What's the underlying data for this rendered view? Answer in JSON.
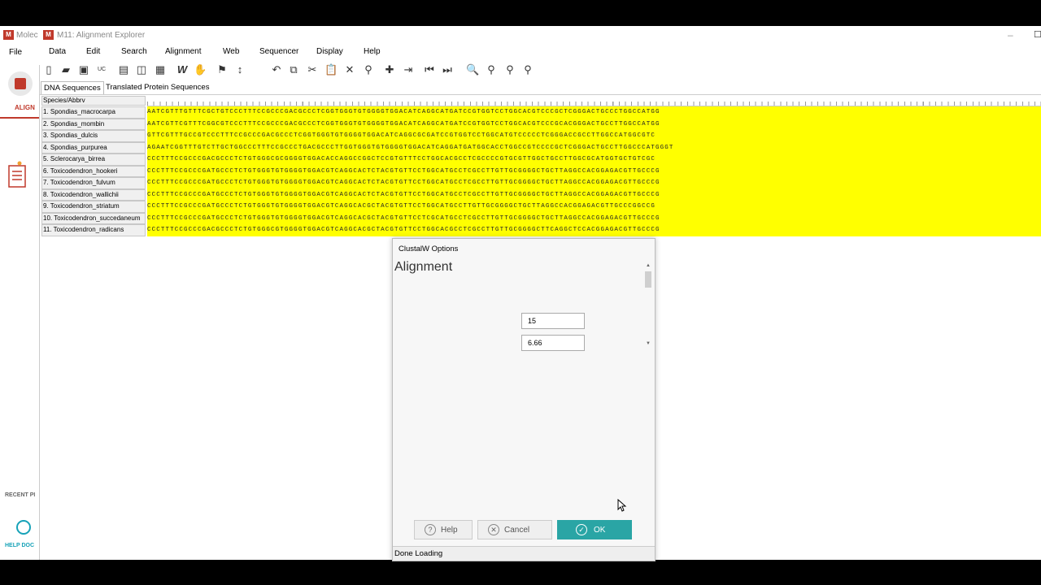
{
  "mega": {
    "title": "Molec",
    "file_menu": "File",
    "align_label": "ALIGN",
    "recent_label": "RECENT PI",
    "help_label": "HELP DOC"
  },
  "window": {
    "title": "M11: Alignment Explorer",
    "menus": [
      "Data",
      "Edit",
      "Search",
      "Alignment",
      "Web",
      "Sequencer",
      "Display",
      "Help"
    ],
    "tabs": [
      "DNA Sequences",
      "Translated Protein Sequences"
    ],
    "active_tab": "DNA Sequences"
  },
  "toolbar_icons": [
    "new-file-icon",
    "open-folder-icon",
    "save-icon",
    "uppercase-icon",
    "page-icon",
    "columns-icon",
    "grid-icon",
    "w-align-icon",
    "muscle-icon",
    "flag-icon",
    "sort-icon",
    "undo-icon",
    "copy-icon",
    "cut-icon",
    "paste-icon",
    "delete-icon",
    "find-icon",
    "add-icon",
    "import-icon",
    "prev-icon",
    "next-icon",
    "zoom-search-icon",
    "search-prev-icon",
    "search-next-icon",
    "search-clear-icon"
  ],
  "grid": {
    "header": "Species/Abbrv",
    "rows": [
      {
        "name": "1. Spondias_macrocarpa",
        "seq": "AATCGTTTGTTTCGCTGTCCCTTTCCGCCCGACGCCCTCGGTGGGTGTGGGGTGGACATCAGGCATGATCCGTGGTCCTGGCACGTCCCGCTCGGGACTGCCCTGGCCATGG"
      },
      {
        "name": "2. Spondias_mombin",
        "seq": "AATCGTTCGTTTCGGCGTCCCTTTCCGCCCGACGCCCTCGGTGGGTGTGGGGTGGACATCAGGCATGATCCGTGGTCCTGGCACGTCCCGCACGGGACTGCCTTGGCCATGG"
      },
      {
        "name": "3. Spondias_dulcis",
        "seq": "GTTCGTTTGCCGTCCCTTTCCGCCCGACGCCCTCGGTGGGTGTGGGGTGGACATCAGGCGCGATCCGTGGTCCTGGCATGTCCCCCTCGGGACCGCCTTGGCCATGGCGTC"
      },
      {
        "name": "4. Spondias_purpurea",
        "seq": "AGAATCGGTTTGTCTTGCTGGCCCTTTCCGCCCTGACGCCCTTGGTGGGTGTGGGGTGGACATCAGGATGATGGCACCTGGCCGTCCCCGCTCGGGACTGCCTTGGCCCATGGGT"
      },
      {
        "name": "5. Sclerocarya_birrea",
        "seq": "CCCTTTCCGCCCGACGCCCTCTGTGGGCGCGGGGTGGACACCAGGCCGGCTCCGTGTTTCCTGGCACGCCTCGCCCCGTGCGTTGGCTGCCTTGGCGCATGGTGCTGTCGC"
      },
      {
        "name": "6. Toxicodendron_hookeri",
        "seq": "CCCTTTCCGCCCGATGCCCTCTGTGGGTGTGGGGTGGACGTCAGGCACTCTACGTGTTCCTGGCATGCCTCGCCTTGTTGCGGGGCTGCTTAGGCCACGGAGACGTTGCCCG"
      },
      {
        "name": "7. Toxicodendron_fulvum",
        "seq": "CCCTTTCCGCCCGATGCCCTCTGTGGGTGTGGGGTGGACGTCAGGCACTCTACGTGTTCCTGGCATGCCTCGCCTTGTTGCGGGGCTGCTTAGGCCACGGAGACGTTGCCCG"
      },
      {
        "name": "8. Toxicodendron_wallichii",
        "seq": "CCCTTTCCGCCCGATGCCCTCTGTGGGTGTGGGGTGGACGTCAGGCACTCTACGTGTTCCTGGCATGCCTCGCCTTGTTGCGGGGCTGCTTAGGCCACGGAGACGTTGCCCG"
      },
      {
        "name": "9. Toxicodendron_striatum",
        "seq": "CCCTTTCCGCCCGATGCCCTCTGTGGGTGTGGGGTGGACGTCAGGCACGCTACGTGTTCCTGGCATGCCTTGTTGCGGGGCTGCTTAGGCCACGGAGACGTTGCCCGGCCG"
      },
      {
        "name": "10. Toxicodendron_succedaneum",
        "seq": "CCCTTTCCGCCCGATGCCCTCTGTGGGTGTGGGGTGGACGTCAGGCACGCTACGTGTTCCTCGCATGCCTCGCCTTGTTGCGGGGCTGCTTAGGCCACGGAGACGTTGCCCG"
      },
      {
        "name": "11. Toxicodendron_radicans",
        "seq": "CCCTTTCCGCCCGACGCCCTCTGTGGGCGTGGGGTGGACGTCAGGCACGCTACGTGTTCCTGGCACGCCTCGCCTTGTTGCGGGGCTTCAGGCTCCACGGAGACGTTGCCCG"
      }
    ]
  },
  "dialog": {
    "title": "ClustalW Options",
    "heading": "Alignment",
    "field1_value": "15",
    "field2_value": "6.66",
    "help_label": "Help",
    "cancel_label": "Cancel",
    "ok_label": "OK",
    "status": "Done Loading"
  },
  "colors": {
    "sequence_bg": "#ffff00",
    "ok_button": "#2aa5a5",
    "brand": "#c0392b"
  }
}
